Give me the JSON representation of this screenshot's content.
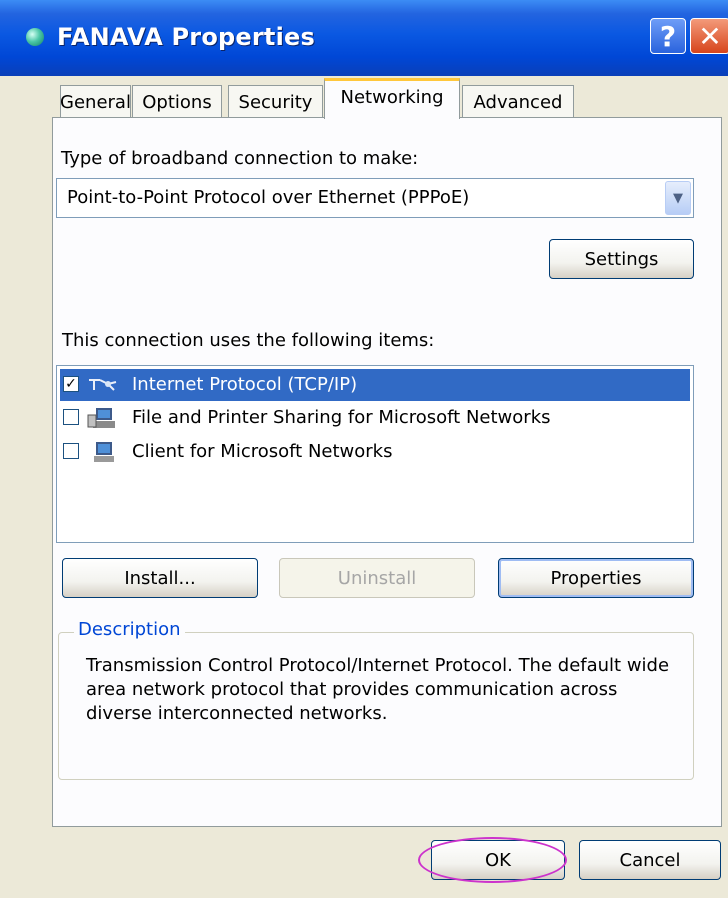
{
  "window": {
    "title": "FANAVA Properties",
    "help_label": "?",
    "close_label": "✕"
  },
  "tabs": [
    {
      "label": "General"
    },
    {
      "label": "Options"
    },
    {
      "label": "Security"
    },
    {
      "label": "Networking",
      "active": true
    },
    {
      "label": "Advanced"
    }
  ],
  "networking": {
    "type_label": "Type of broadband connection to make:",
    "connection_type": "Point-to-Point Protocol over Ethernet (PPPoE)",
    "settings_button": "Settings",
    "items_label": "This connection uses the following items:",
    "items": [
      {
        "label": "Internet Protocol (TCP/IP)",
        "checked": true,
        "selected": true,
        "icon": "network-protocol-icon"
      },
      {
        "label": "File and Printer Sharing for Microsoft Networks",
        "checked": false,
        "selected": false,
        "icon": "network-service-icon"
      },
      {
        "label": "Client for Microsoft Networks",
        "checked": false,
        "selected": false,
        "icon": "network-client-icon"
      }
    ],
    "install_button": "Install...",
    "uninstall_button": "Uninstall",
    "properties_button": "Properties",
    "description_title": "Description",
    "description_text": "Transmission Control Protocol/Internet Protocol. The default wide area network protocol that provides communication across diverse interconnected networks."
  },
  "footer": {
    "ok_button": "OK",
    "cancel_button": "Cancel"
  },
  "colors": {
    "title_bar": "#0047d6",
    "selection": "#316ac5",
    "highlight_ring": "#cc33cc",
    "tab_accent": "#ffc73c"
  }
}
